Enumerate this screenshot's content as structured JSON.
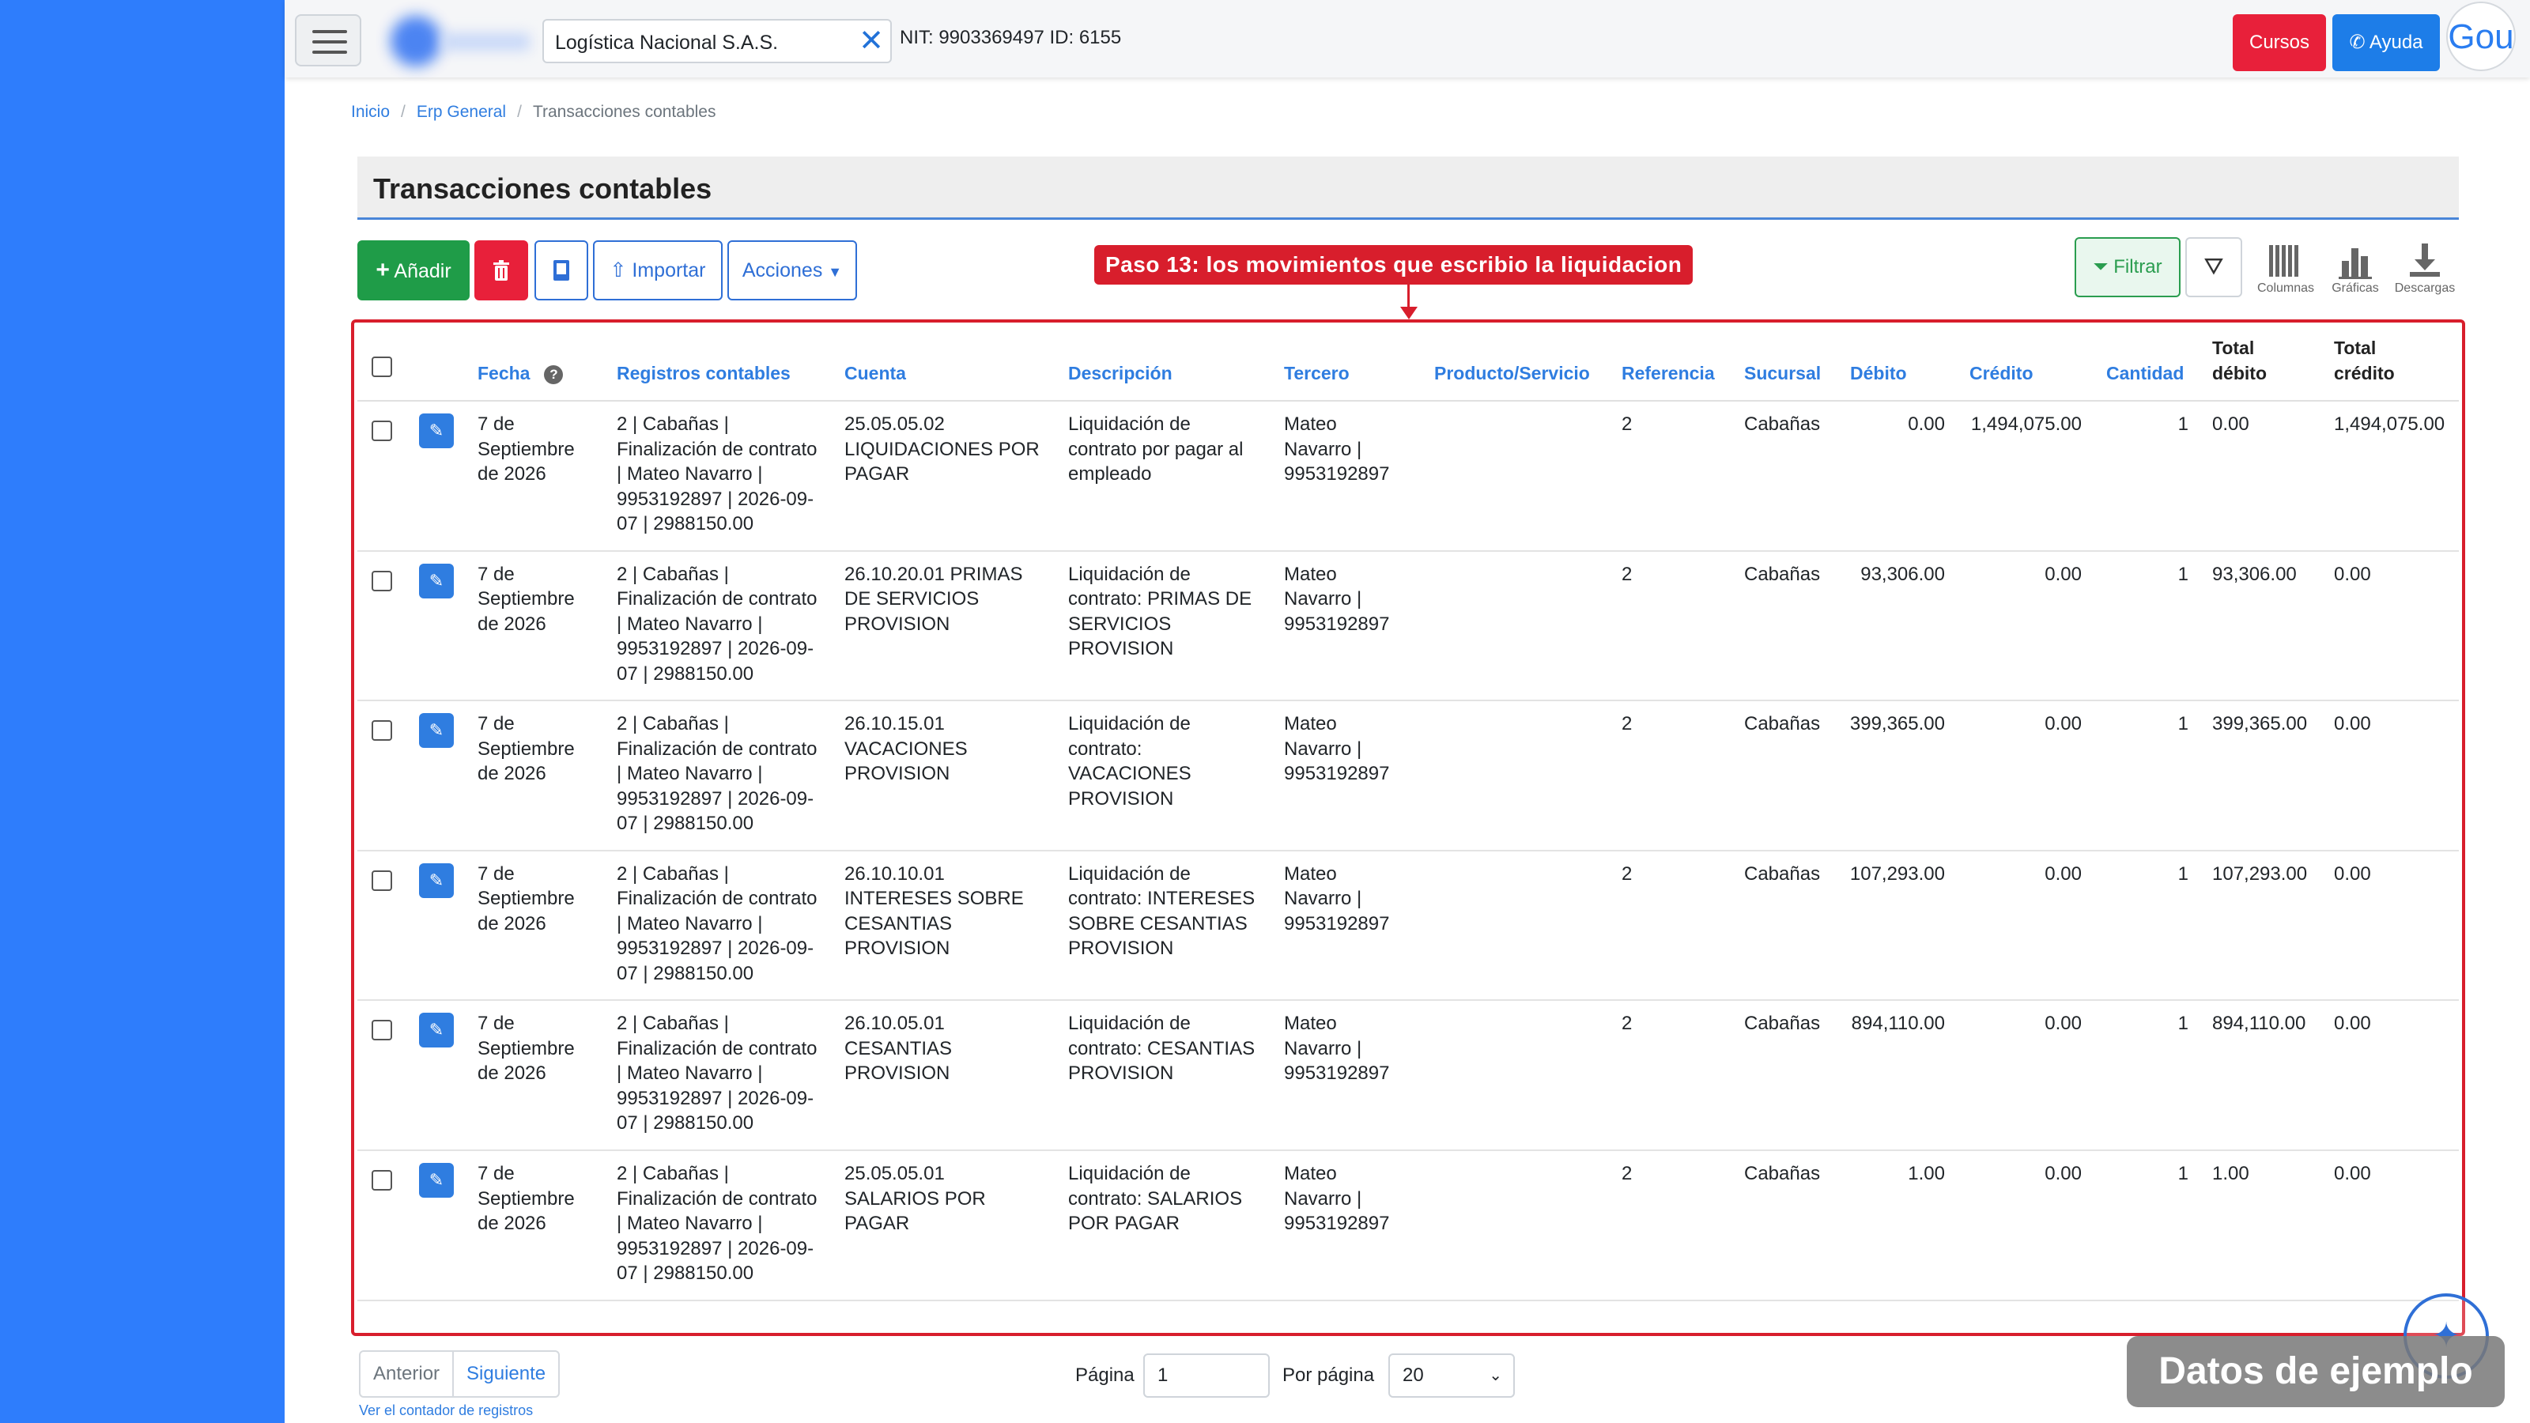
{
  "topbar": {
    "company": "Logística Nacional S.A.S.",
    "nit_text": "NIT: 9903369497 ID: 6155",
    "cursos_label": "Cursos",
    "ayuda_label": "Ayuda",
    "avatar_text": "Gou"
  },
  "breadcrumb": {
    "home": "Inicio",
    "section": "Erp General",
    "current": "Transacciones contables"
  },
  "page": {
    "title": "Transacciones contables"
  },
  "toolbar": {
    "add_label": "Añadir",
    "import_label": "Importar",
    "actions_label": "Acciones",
    "filter_label": "Filtrar",
    "columns_label": "Columnas",
    "charts_label": "Gráficas",
    "downloads_label": "Descargas"
  },
  "annotation": {
    "text": "Paso 13: los movimientos que escribio la liquidacion"
  },
  "table": {
    "headers": {
      "fecha": "Fecha",
      "registros": "Registros contables",
      "cuenta": "Cuenta",
      "descripcion": "Descripción",
      "tercero": "Tercero",
      "producto": "Producto/Servicio",
      "referencia": "Referencia",
      "sucursal": "Sucursal",
      "debito": "Débito",
      "credito": "Crédito",
      "cantidad": "Cantidad",
      "total_debito_1": "Total",
      "total_debito_2": "débito",
      "total_credito_1": "Total",
      "total_credito_2": "crédito"
    },
    "rows": [
      {
        "fecha": [
          "7 de",
          "Septiembre",
          "de 2026"
        ],
        "registro": [
          "2 | Cabañas |",
          "Finalización de contrato",
          "| Mateo Navarro |",
          "9953192897 | 2026-09-",
          "07 | 2988150.00"
        ],
        "cuenta": [
          "25.05.05.02",
          "LIQUIDACIONES POR",
          "PAGAR"
        ],
        "descripcion": [
          "Liquidación de",
          "contrato por pagar al",
          "empleado"
        ],
        "tercero": [
          "Mateo",
          "Navarro |",
          "9953192897"
        ],
        "producto": "",
        "referencia": "2",
        "sucursal": "Cabañas",
        "debito": "0.00",
        "credito": "1,494,075.00",
        "cantidad": "1",
        "total_debito": "0.00",
        "total_credito": "1,494,075.00"
      },
      {
        "fecha": [
          "7 de",
          "Septiembre",
          "de 2026"
        ],
        "registro": [
          "2 | Cabañas |",
          "Finalización de contrato",
          "| Mateo Navarro |",
          "9953192897 | 2026-09-",
          "07 | 2988150.00"
        ],
        "cuenta": [
          "26.10.20.01 PRIMAS",
          "DE SERVICIOS",
          "PROVISION"
        ],
        "descripcion": [
          "Liquidación de",
          "contrato: PRIMAS DE",
          "SERVICIOS",
          "PROVISION"
        ],
        "tercero": [
          "Mateo",
          "Navarro |",
          "9953192897"
        ],
        "producto": "",
        "referencia": "2",
        "sucursal": "Cabañas",
        "debito": "93,306.00",
        "credito": "0.00",
        "cantidad": "1",
        "total_debito": "93,306.00",
        "total_credito": "0.00"
      },
      {
        "fecha": [
          "7 de",
          "Septiembre",
          "de 2026"
        ],
        "registro": [
          "2 | Cabañas |",
          "Finalización de contrato",
          "| Mateo Navarro |",
          "9953192897 | 2026-09-",
          "07 | 2988150.00"
        ],
        "cuenta": [
          "26.10.15.01",
          "VACACIONES",
          "PROVISION"
        ],
        "descripcion": [
          "Liquidación de",
          "contrato:",
          "VACACIONES",
          "PROVISION"
        ],
        "tercero": [
          "Mateo",
          "Navarro |",
          "9953192897"
        ],
        "producto": "",
        "referencia": "2",
        "sucursal": "Cabañas",
        "debito": "399,365.00",
        "credito": "0.00",
        "cantidad": "1",
        "total_debito": "399,365.00",
        "total_credito": "0.00"
      },
      {
        "fecha": [
          "7 de",
          "Septiembre",
          "de 2026"
        ],
        "registro": [
          "2 | Cabañas |",
          "Finalización de contrato",
          "| Mateo Navarro |",
          "9953192897 | 2026-09-",
          "07 | 2988150.00"
        ],
        "cuenta": [
          "26.10.10.01",
          "INTERESES SOBRE",
          "CESANTIAS",
          "PROVISION"
        ],
        "descripcion": [
          "Liquidación de",
          "contrato: INTERESES",
          "SOBRE CESANTIAS",
          "PROVISION"
        ],
        "tercero": [
          "Mateo",
          "Navarro |",
          "9953192897"
        ],
        "producto": "",
        "referencia": "2",
        "sucursal": "Cabañas",
        "debito": "107,293.00",
        "credito": "0.00",
        "cantidad": "1",
        "total_debito": "107,293.00",
        "total_credito": "0.00"
      },
      {
        "fecha": [
          "7 de",
          "Septiembre",
          "de 2026"
        ],
        "registro": [
          "2 | Cabañas |",
          "Finalización de contrato",
          "| Mateo Navarro |",
          "9953192897 | 2026-09-",
          "07 | 2988150.00"
        ],
        "cuenta": [
          "26.10.05.01",
          "CESANTIAS",
          "PROVISION"
        ],
        "descripcion": [
          "Liquidación de",
          "contrato: CESANTIAS",
          "PROVISION"
        ],
        "tercero": [
          "Mateo",
          "Navarro |",
          "9953192897"
        ],
        "producto": "",
        "referencia": "2",
        "sucursal": "Cabañas",
        "debito": "894,110.00",
        "credito": "0.00",
        "cantidad": "1",
        "total_debito": "894,110.00",
        "total_credito": "0.00"
      },
      {
        "fecha": [
          "7 de",
          "Septiembre",
          "de 2026"
        ],
        "registro": [
          "2 | Cabañas |",
          "Finalización de contrato",
          "| Mateo Navarro |",
          "9953192897 | 2026-09-",
          "07 | 2988150.00"
        ],
        "cuenta": [
          "25.05.05.01",
          "SALARIOS POR",
          "PAGAR"
        ],
        "descripcion": [
          "Liquidación de",
          "contrato: SALARIOS",
          "POR PAGAR"
        ],
        "tercero": [
          "Mateo",
          "Navarro |",
          "9953192897"
        ],
        "producto": "",
        "referencia": "2",
        "sucursal": "Cabañas",
        "debito": "1.00",
        "credito": "0.00",
        "cantidad": "1",
        "total_debito": "1.00",
        "total_credito": "0.00"
      }
    ]
  },
  "pagination": {
    "prev_label": "Anterior",
    "next_label": "Siguiente",
    "count_link": "Ver el contador de registros",
    "page_label": "Página",
    "page_value": "1",
    "per_page_label": "Por página",
    "per_page_value": "20"
  },
  "watermark": "Datos de ejemplo",
  "colors": {
    "sidebar": "#2e7dfc",
    "danger": "#e8203a",
    "success": "#1f9c48",
    "primary": "#2f7de0",
    "annotation": "#d81e2c"
  }
}
